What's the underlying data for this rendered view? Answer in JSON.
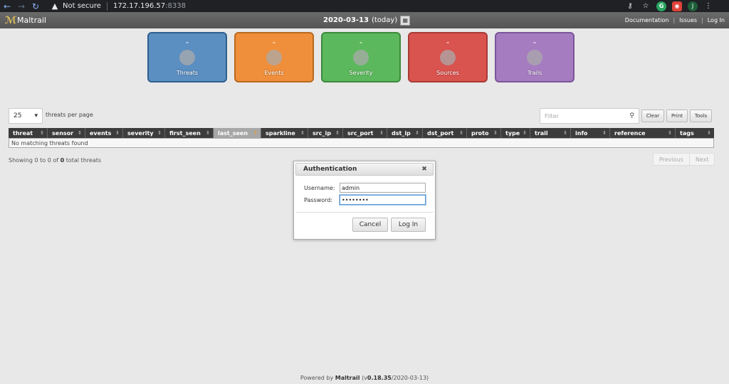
{
  "browser": {
    "security_label": "Not secure",
    "host": "172.17.196.57",
    "port": ":8338",
    "profile_initial": "J"
  },
  "header": {
    "app_name": "Maltrail",
    "logo_glyph": "ℳ",
    "date": "2020-03-13",
    "date_suffix": "(today)",
    "links": [
      "Documentation",
      "Issues",
      "Log In"
    ]
  },
  "tiles": [
    {
      "label": "Threats",
      "value": "–",
      "bg": "#5b8ec1",
      "border": "#2f5f8f"
    },
    {
      "label": "Events",
      "value": "–",
      "bg": "#ef8f3c",
      "border": "#b86a1e"
    },
    {
      "label": "Severity",
      "value": "–",
      "bg": "#5cb85c",
      "border": "#3c8a3c"
    },
    {
      "label": "Sources",
      "value": "–",
      "bg": "#d9534f",
      "border": "#a83a36"
    },
    {
      "label": "Trails",
      "value": "–",
      "bg": "#a67cc1",
      "border": "#7a559a"
    }
  ],
  "controls": {
    "per_page_value": "25",
    "per_page_label": "threats per page",
    "filter_placeholder": "Filter",
    "buttons": [
      "Clear",
      "Print",
      "Tools"
    ]
  },
  "table": {
    "columns": [
      "threat",
      "sensor",
      "events",
      "severity",
      "first_seen",
      "last_seen",
      "sparkline",
      "src_ip",
      "src_port",
      "dst_ip",
      "dst_port",
      "proto",
      "type",
      "trail",
      "info",
      "reference",
      "tags"
    ],
    "active_column": "last_seen",
    "empty_message": "No matching threats found"
  },
  "status": {
    "showing_prefix": "Showing 0 to 0 of",
    "total": "0",
    "showing_suffix": "total threats"
  },
  "pager": {
    "previous": "Previous",
    "next": "Next"
  },
  "dialog": {
    "title": "Authentication",
    "username_label": "Username:",
    "username_value": "admin",
    "password_label": "Password:",
    "password_value": "••••••••",
    "cancel_label": "Cancel",
    "login_label": "Log In"
  },
  "footer": {
    "prefix": "Powered by",
    "brand": "Maltrail",
    "version_open": "(v",
    "version": "0.18.35",
    "version_close": "/2020-03-13)"
  }
}
